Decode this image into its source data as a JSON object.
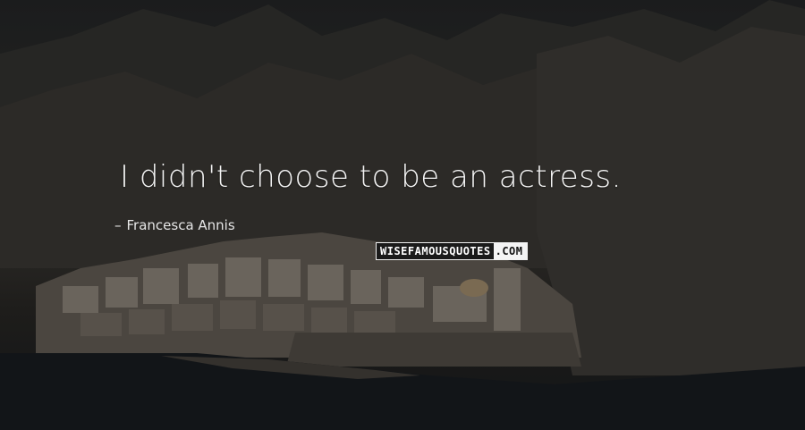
{
  "quote": {
    "text": "I didn't choose to be an actress.",
    "author_dash": "–",
    "author": "Francesca Annis"
  },
  "watermark": {
    "part1": "WISEFAMOUSQUOTES",
    "part2": ".COM"
  },
  "colors": {
    "text": "#f4f4f4",
    "background": "#1e1d1b"
  }
}
